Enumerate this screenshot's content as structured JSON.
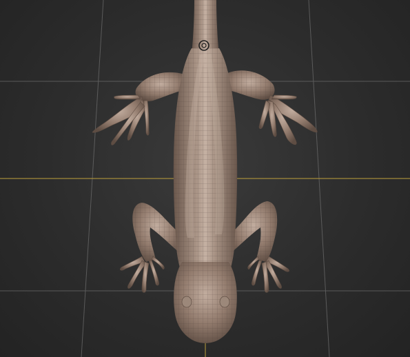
{
  "viewport": {
    "title": "",
    "background_color": "#2b2b2b",
    "grid_color": "#6b6b6b",
    "axis_color": "#b89b3c",
    "model_color": "#8a7466",
    "model_highlight": "#b9a497",
    "wire_color": "#5a4a42",
    "model_name": "lizard",
    "pivot_icon": "transform-pivot-icon"
  }
}
